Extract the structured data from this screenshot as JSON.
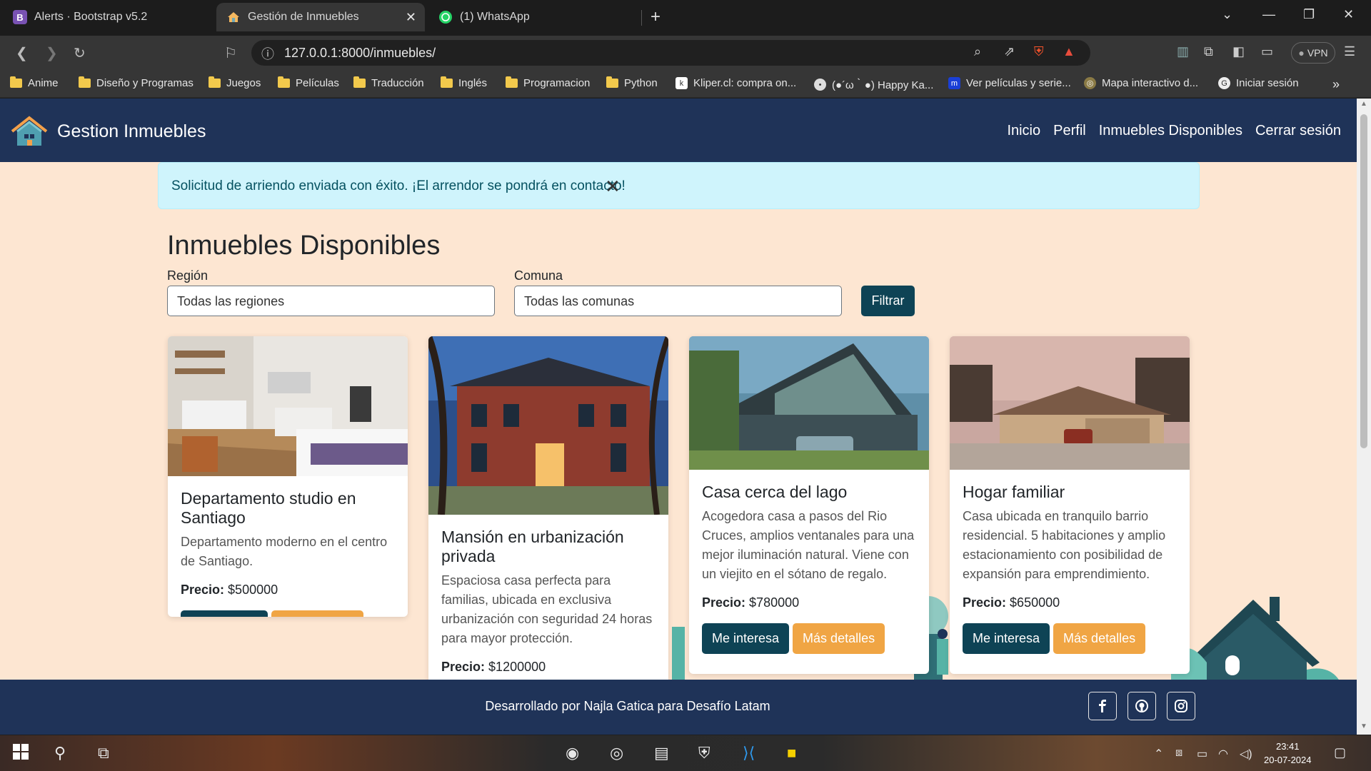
{
  "browser": {
    "tabs": [
      {
        "title": "Alerts · Bootstrap v5.2",
        "favicon": "B"
      },
      {
        "title": "Gestión de Inmuebles",
        "favicon": "house"
      },
      {
        "title": "(1) WhatsApp",
        "favicon": "whatsapp"
      }
    ],
    "url": "127.0.0.1:8000/inmuebles/",
    "vpn_label": "VPN",
    "bookmarks": [
      "Anime",
      "Diseño y Programas",
      "Juegos",
      "Películas",
      "Traducción",
      "Inglés",
      "Programacion",
      "Python",
      "Kliper.cl: compra on...",
      "(●´ω｀●) Happy Ka...",
      "Ver películas y serie...",
      "Mapa interactivo d...",
      "Iniciar sesión"
    ]
  },
  "app": {
    "brand": "Gestion Inmuebles",
    "nav": [
      "Inicio",
      "Perfil",
      "Inmuebles Disponibles",
      "Cerrar sesión"
    ],
    "alert": "Solicitud de arriendo enviada con éxito. ¡El arrendor se pondrá en contacto!",
    "page_title": "Inmuebles Disponibles",
    "filters": {
      "region_label": "Región",
      "region_value": "Todas las regiones",
      "comuna_label": "Comuna",
      "comuna_value": "Todas las comunas",
      "button": "Filtrar"
    },
    "price_label": "Precio:",
    "btn_interest": "Me interesa",
    "btn_details": "Más detalles",
    "cards": [
      {
        "title": "Departamento studio en Santiago",
        "text": "Departamento moderno en el centro de Santiago.",
        "price": "$500000"
      },
      {
        "title": "Mansión en urbanización privada",
        "text": "Espaciosa casa perfecta para familias, ubicada en exclusiva urbanización con seguridad 24 horas para mayor protección.",
        "price": "$1200000"
      },
      {
        "title": "Casa cerca del lago",
        "text": "Acogedora casa a pasos del Rio Cruces, amplios ventanales para una mejor iluminación natural. Viene con un viejito en el sótano de regalo.",
        "price": "$780000"
      },
      {
        "title": "Hogar familiar",
        "text": "Casa ubicada en tranquilo barrio residencial. 5 habitaciones y amplio estacionamiento con posibilidad de expansión para emprendimiento.",
        "price": "$650000"
      }
    ],
    "footer": "Desarrollado por Najla Gatica para Desafío Latam",
    "social": [
      "facebook-icon",
      "github-icon",
      "instagram-icon"
    ]
  },
  "taskbar": {
    "time": "23:41",
    "date": "20-07-2024"
  },
  "colors": {
    "navbar": "#1f3358",
    "page_bg": "#fde6d2",
    "primary_btn": "#0e4355",
    "warning_btn": "#f0a544",
    "alert_bg": "#cff4fc"
  }
}
